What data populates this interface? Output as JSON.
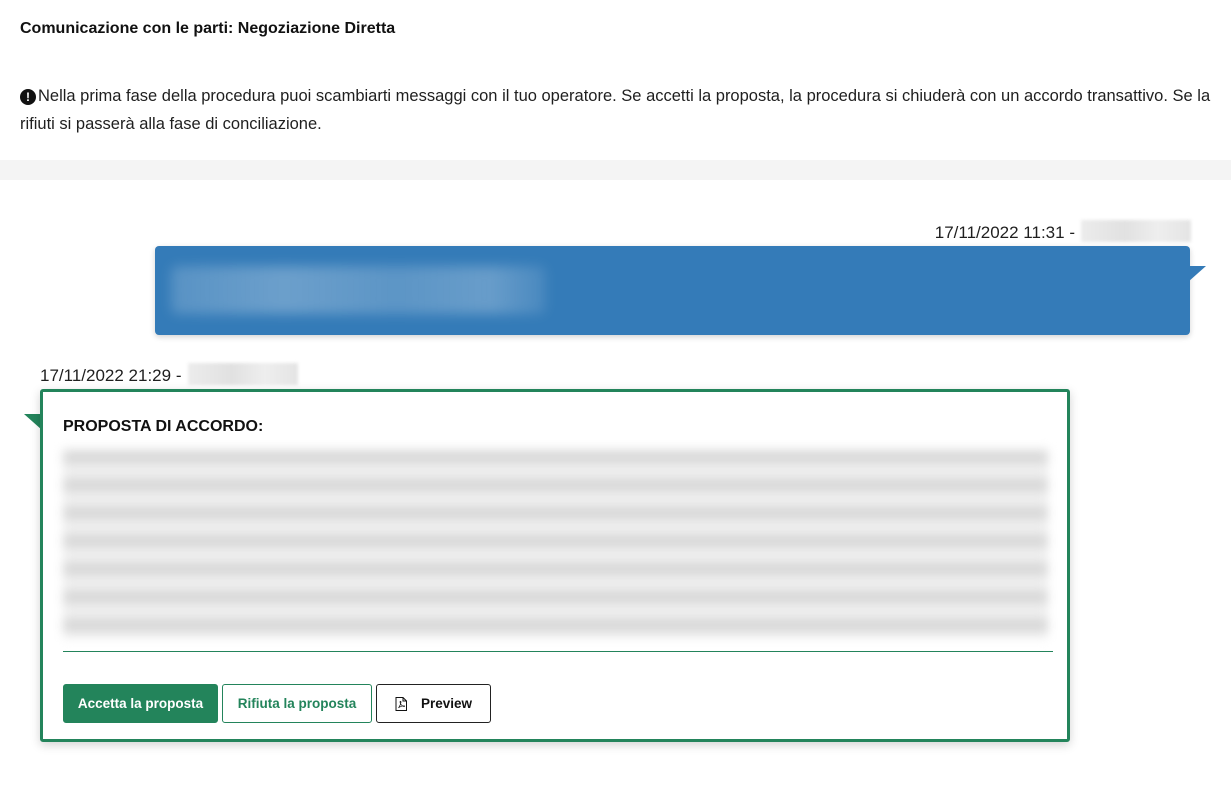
{
  "header": {
    "title": "Comunicazione con le parti: Negoziazione Diretta",
    "info_text": "Nella prima fase della procedura puoi scambiarti messaggi con il tuo operatore. Se accetti la proposta, la procedura si chiuderà con un accordo transattivo. Se la rifiuti si passerà alla fase di conciliazione.",
    "info_icon": "exclamation-circle-icon"
  },
  "messages": [
    {
      "timestamp": "17/11/2022 11:31",
      "separator": "-",
      "sender_redacted": true,
      "body_redacted": true,
      "color": "#347bb8"
    },
    {
      "timestamp": "17/11/2022 21:29",
      "separator": "-",
      "sender_redacted": true,
      "proposal": {
        "title": "PROPOSTA DI ACCORDO:",
        "body_redacted": true,
        "accept_label": "Accetta la proposta",
        "reject_label": "Rifiuta la proposta",
        "preview_label": "Preview",
        "preview_icon": "file-pdf-icon",
        "accent_color": "#23845b"
      }
    }
  ]
}
